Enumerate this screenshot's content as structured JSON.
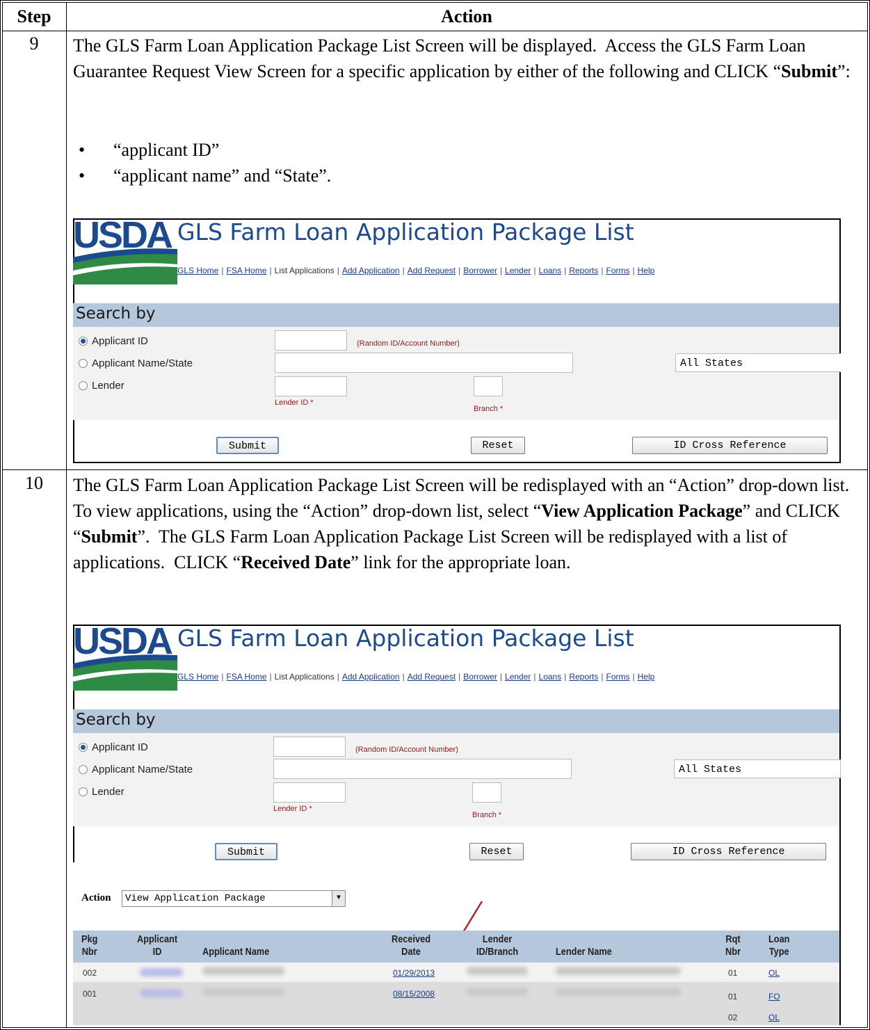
{
  "table": {
    "header_step": "Step",
    "header_action": "Action"
  },
  "steps": [
    {
      "number": "9",
      "text": "The GLS Farm Loan Application Package List Screen will be displayed.  Access the GLS Farm Loan Guarantee Request View Screen for a specific application by either of the following and CLICK “Submit”:",
      "bullets": [
        "“applicant ID”",
        "“applicant name” and “State”."
      ]
    },
    {
      "number": "10",
      "text": "The GLS Farm Loan Application Package List Screen will be redisplayed with an “Action” drop-down list.  To view applications, using the “Action” drop-down list, select “View Application Package” and CLICK “Submit”.  The GLS Farm Loan Application Package List Screen will be redisplayed with a list of applications.  CLICK “Received Date” link for the appropriate loan."
    }
  ],
  "screen": {
    "logo": "USDA",
    "title": "GLS Farm Loan Application Package List",
    "nav": [
      "GLS Home",
      "FSA Home",
      "List Applications",
      "Add Application",
      "Add Request",
      "Borrower",
      "Lender",
      "Loans",
      "Reports",
      "Forms",
      "Help"
    ],
    "search_title": "Search by",
    "radio_applicant_id": "Applicant ID",
    "radio_applicant_name": "Applicant Name/State",
    "radio_lender": "Lender",
    "hint_random": "(Random ID/Account Number)",
    "hint_lender_id": "Lender ID *",
    "hint_branch": "Branch *",
    "state_select": "All States",
    "btn_submit": "Submit",
    "btn_reset": "Reset",
    "btn_crossref": "ID Cross Reference",
    "action_label": "Action",
    "action_value": "View Application Package",
    "columns": {
      "pkg": [
        "Pkg",
        "Nbr"
      ],
      "applicant_id": [
        "Applicant",
        "ID"
      ],
      "applicant_name": "Applicant Name",
      "received": [
        "Received",
        "Date"
      ],
      "lender": [
        "Lender",
        "ID/Branch"
      ],
      "lender_name": "Lender Name",
      "rqt": [
        "Rqt",
        "Nbr"
      ],
      "loan_type": [
        "Loan",
        "Type"
      ]
    },
    "rows": [
      {
        "pkg": "002",
        "date": "01/29/2013",
        "rqt": "01",
        "type": "OL"
      },
      {
        "pkg": "001",
        "date": "08/15/2008",
        "rqt": "01",
        "type": "FO"
      },
      {
        "pkg": "",
        "date": "",
        "rqt": "02",
        "type": "OL"
      }
    ]
  }
}
